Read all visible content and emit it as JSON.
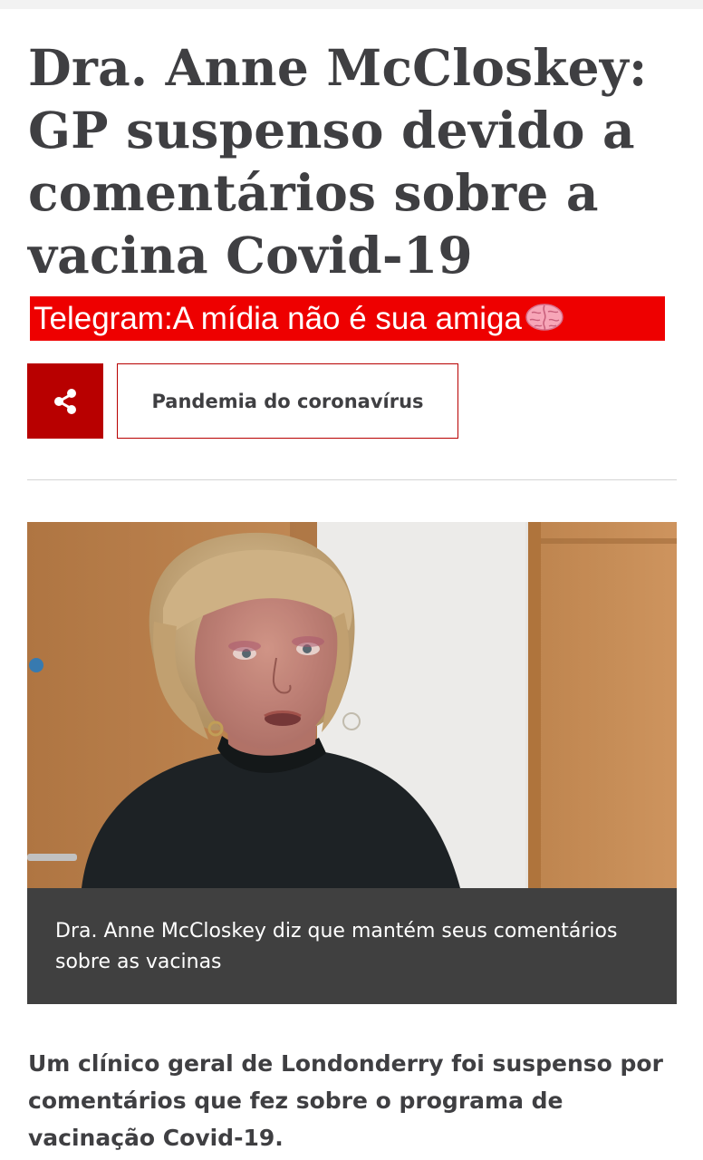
{
  "article": {
    "headline": "Dra. Anne McCloskey: GP suspenso devido a comentários sobre a vacina Covid-19",
    "watermark": "Telegram:A mídia não é sua amiga",
    "topic": "Pandemia do coronavírus",
    "image_caption": "Dra. Anne McCloskey diz que mantém seus comentários sobre as vacinas",
    "lede": "Um clínico geral de Londonderry foi suspenso por comentários que fez sobre o programa de vacinação Covid-19."
  },
  "icons": {
    "share": "share-icon",
    "brain": "brain-emoji"
  },
  "colors": {
    "brand_red": "#b80000",
    "banner_red": "#ee0000",
    "text": "#3f3f42",
    "caption_bg": "#404040"
  }
}
